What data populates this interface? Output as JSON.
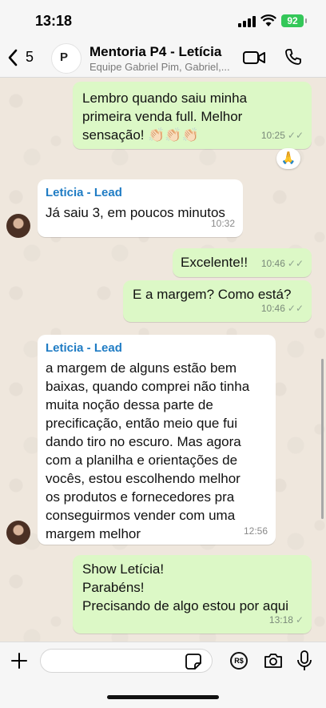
{
  "status_bar": {
    "time": "13:18",
    "battery": "92"
  },
  "header": {
    "back_count": "5",
    "title": "Mentoria P4 - Letícia",
    "subtitle": "Equipe Gabriel Pim, Gabriel,...",
    "avatar_text": "P"
  },
  "messages": [
    {
      "id": "m1",
      "direction": "out",
      "text": "Lembro quando saiu minha\nprimeira venda full. Melhor\nsensação! 👏🏻👏🏻👏🏻",
      "time": "10:25",
      "status": "read",
      "reaction": "🙏"
    },
    {
      "id": "m2",
      "direction": "in",
      "sender": "Leticia - Lead",
      "text": "Já saiu 3, em poucos minutos",
      "time": "10:32"
    },
    {
      "id": "m3",
      "direction": "out",
      "text": "Excelente!!",
      "time": "10:46",
      "status": "read"
    },
    {
      "id": "m4",
      "direction": "out",
      "text": "E a margem? Como está?",
      "time": "10:46",
      "status": "read"
    },
    {
      "id": "m5",
      "direction": "in",
      "sender": "Leticia - Lead",
      "text": "a margem de alguns estão bem\nbaixas, quando comprei não tinha\nmuita noção dessa parte de\nprecificação, então meio que fui\ndando tiro no escuro. Mas agora\ncom a planilha e orientações de\nvocês, estou escolhendo melhor\nos produtos e fornecedores pra\nconseguirmos vender com uma\nmargem melhor",
      "time": "12:56"
    },
    {
      "id": "m6",
      "direction": "out",
      "text": "Show Letícia!\nParabéns!\nPrecisando de algo estou por aqui",
      "time": "13:18",
      "status": "delivered"
    }
  ],
  "ticks": {
    "read": "✓✓",
    "delivered": "✓"
  },
  "input_bar": {
    "pay_label": "R$"
  },
  "colors": {
    "outgoing": "#dcf8c6",
    "incoming": "#ffffff",
    "sender": "#1f7cc4",
    "background": "#efe7dd"
  }
}
